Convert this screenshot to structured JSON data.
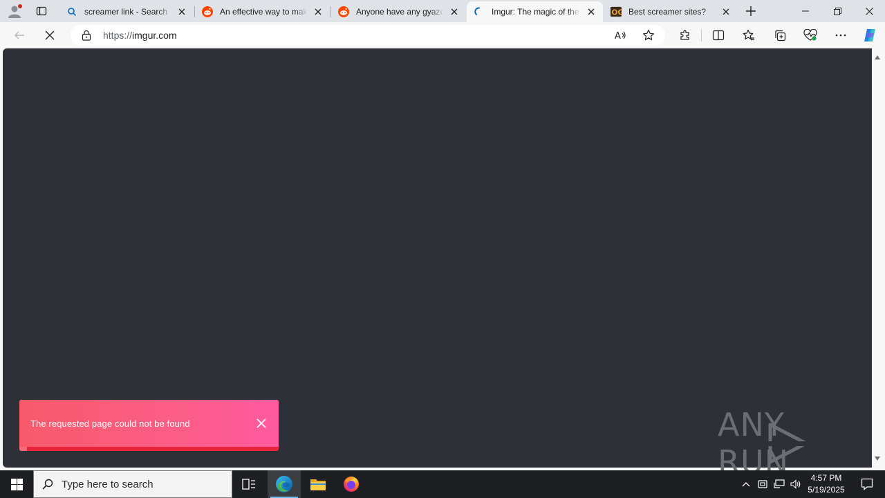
{
  "browser": {
    "tabs": [
      {
        "title": "screamer link - Search",
        "favicon": "search-icon",
        "active": false
      },
      {
        "title": "An effective way to make",
        "favicon": "reddit-icon",
        "active": false
      },
      {
        "title": "Anyone have any gyazo/",
        "favicon": "reddit-icon",
        "active": false
      },
      {
        "title": "Imgur: The magic of the Internet",
        "favicon": "loading-icon",
        "active": true
      },
      {
        "title": "Best screamer sites?",
        "favicon": "og-icon",
        "active": false
      }
    ],
    "address": {
      "scheme": "https://",
      "host": "imgur.com"
    }
  },
  "page": {
    "toast": {
      "message": "The requested page could not be found",
      "progress": 0.03
    },
    "watermark": "ANY RUN"
  },
  "taskbar": {
    "search_placeholder": "Type here to search",
    "time": "4:57 PM",
    "date": "5/19/2025"
  },
  "colors": {
    "page_bg": "#2e3037",
    "toast_start": "#f85a6b",
    "toast_end": "#fe5aa0",
    "accent": "#0067c0"
  }
}
